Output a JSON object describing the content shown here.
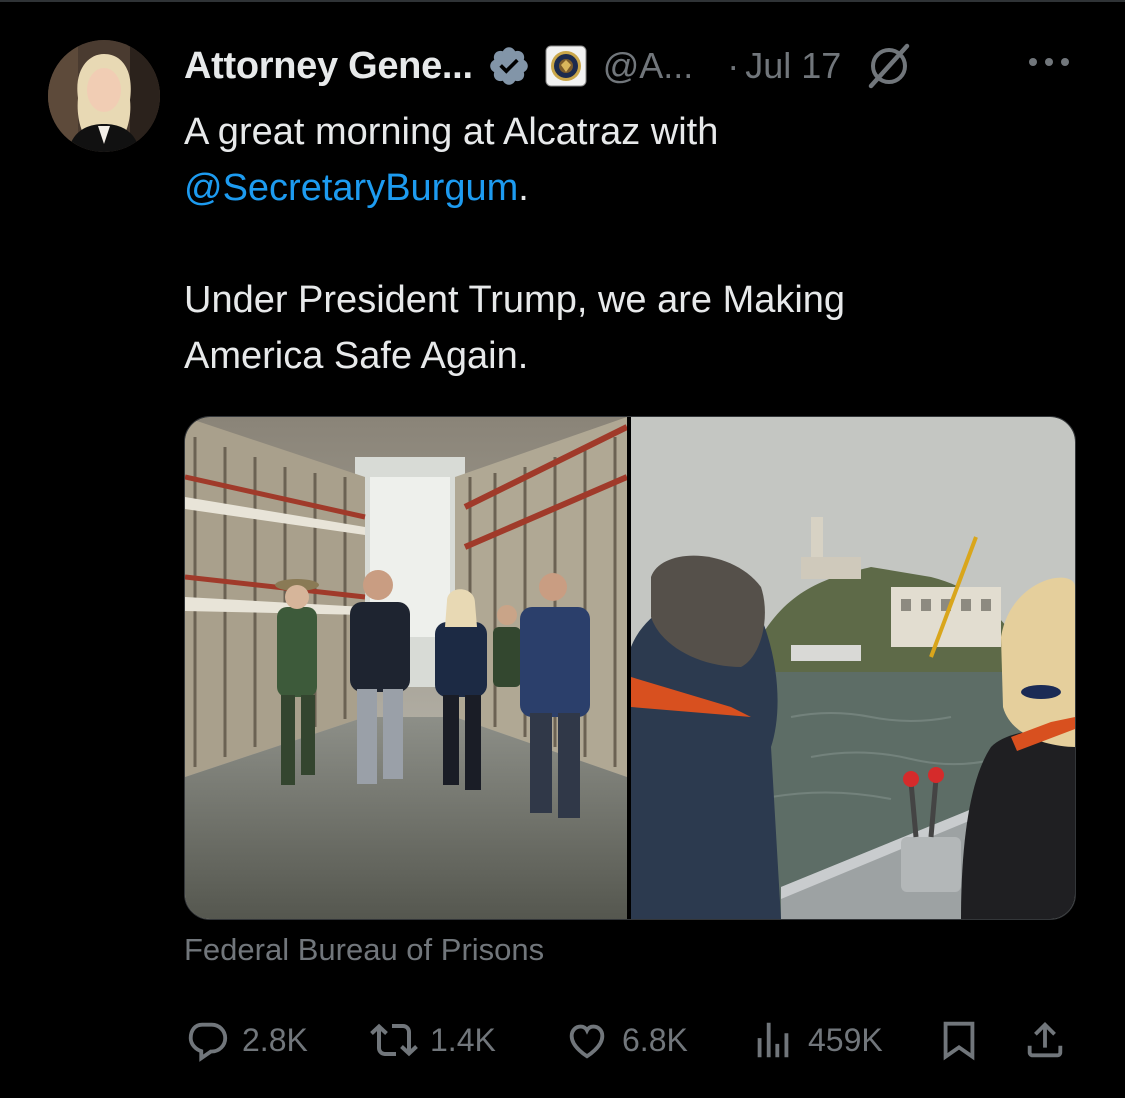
{
  "tweet": {
    "author_name": "Attorney Gene...",
    "handle": "@A...",
    "separator": "·",
    "date": "Jul 17",
    "text_line1": "A great morning at Alcatraz with",
    "mention": "@SecretaryBurgum",
    "mention_suffix": ".",
    "text_line3": "Under President Trump, we are Making",
    "text_line4": "America Safe Again.",
    "media_source": "Federal Bureau of Prisons"
  },
  "actions": {
    "replies": "2.8K",
    "reposts": "1.4K",
    "likes": "6.8K",
    "views": "459K"
  },
  "icons": {
    "verified": "verified-badge-icon",
    "affiliate": "doj-seal-icon",
    "grok": "grok-icon",
    "more": "more-icon",
    "reply": "reply-icon",
    "repost": "repost-icon",
    "like": "like-icon",
    "views": "views-icon",
    "bookmark": "bookmark-icon",
    "share": "share-icon"
  },
  "colors": {
    "background": "#000000",
    "text": "#e7e9ea",
    "muted": "#71767b",
    "link": "#1d9bf0"
  }
}
